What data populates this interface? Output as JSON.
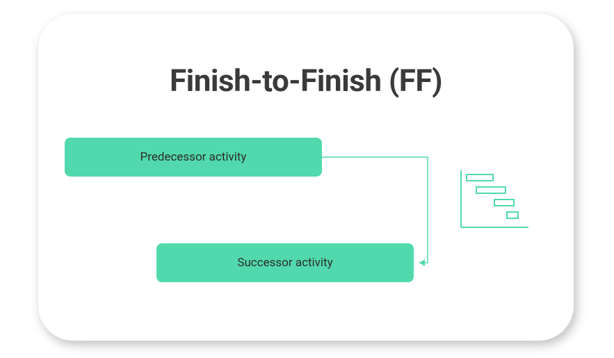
{
  "title": "Finish-to-Finish (FF)",
  "predecessor_label": "Predecessor activity",
  "successor_label": "Successor activity",
  "colors": {
    "accent": "#51d9ad",
    "text_dark": "#3a3a3a"
  }
}
